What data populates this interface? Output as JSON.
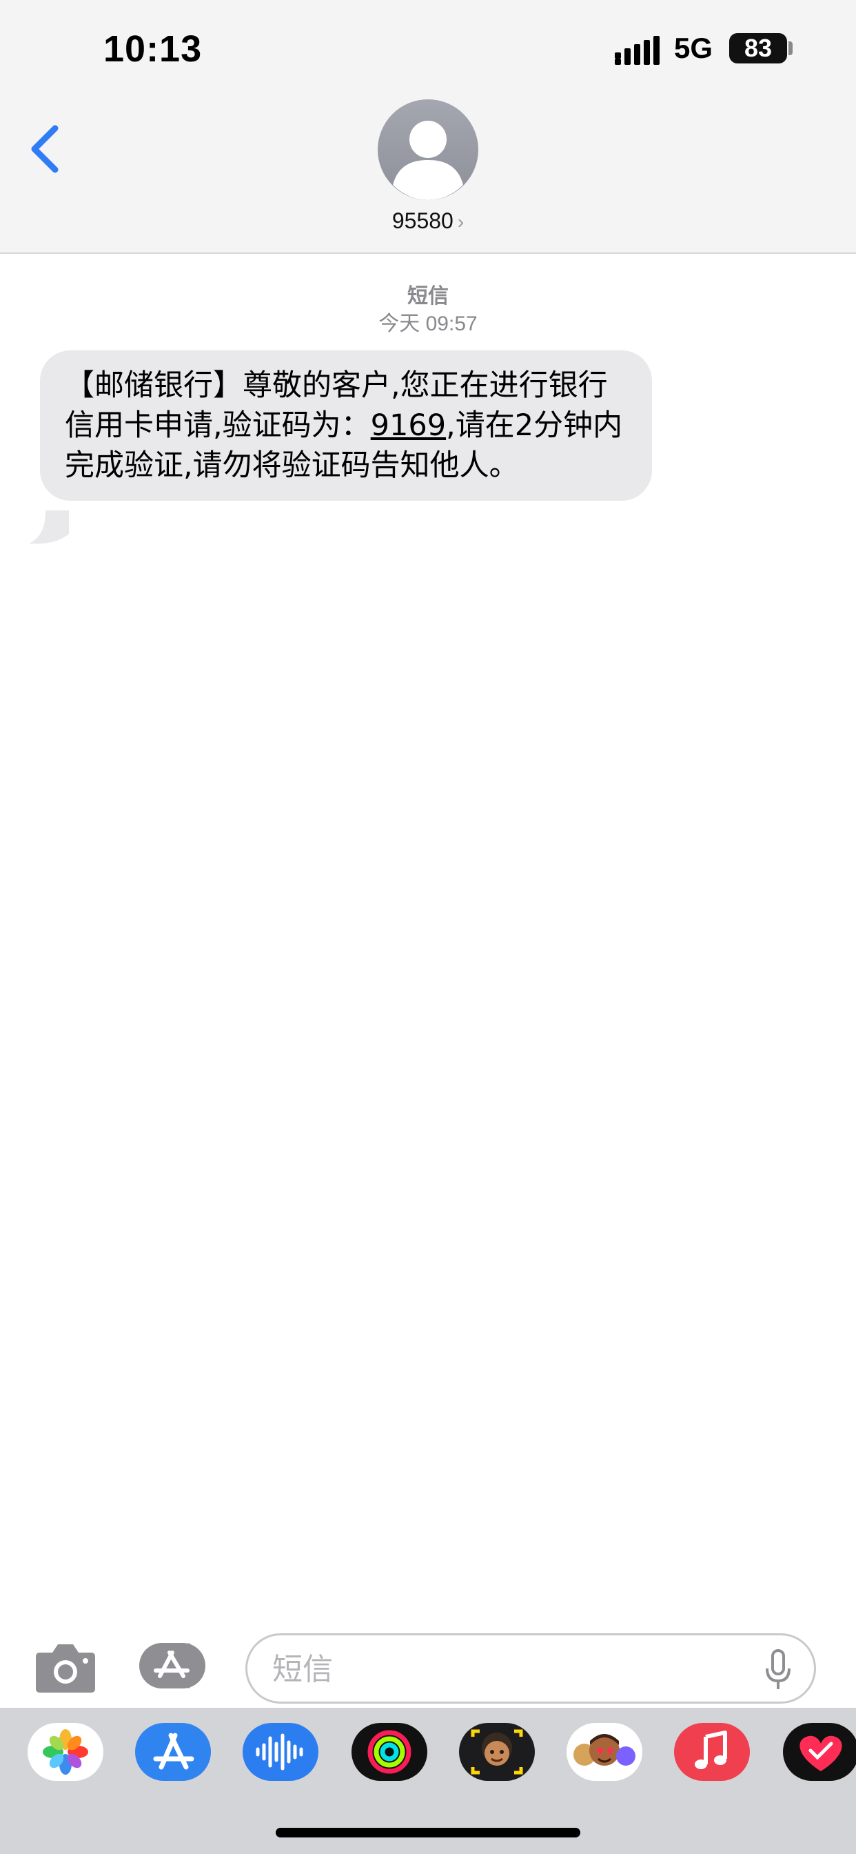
{
  "status_bar": {
    "time": "10:13",
    "network": "5G",
    "battery": "83"
  },
  "nav": {
    "contact": "95580",
    "chevron": "›",
    "back_icon": "chevron-left-icon",
    "avatar_icon": "person-silhouette-icon"
  },
  "conversation": {
    "service": "短信",
    "timestamp": "今天 09:57",
    "message": {
      "before_code": "【邮储银行】尊敬的客户,您正在进行银行信用卡申请,验证码为：",
      "code": "9169",
      "after_code": ",请在2分钟内完成验证,请勿将验证码告知他人。"
    }
  },
  "composer": {
    "placeholder": "短信",
    "value": "",
    "camera_icon": "camera-icon",
    "apps_icon": "app-store-icon",
    "mic_icon": "microphone-icon"
  },
  "app_drawer": {
    "apps": [
      "Photos",
      "App Store",
      "Audio Message",
      "Fitness",
      "Memoji",
      "Animoji",
      "Music",
      "Digital Touch"
    ]
  },
  "colors": {
    "accent": "#2f7cf6",
    "bubble": "#e9e9eb",
    "header_bg": "#f4f4f5",
    "drawer_bg": "#d3d4d8"
  }
}
